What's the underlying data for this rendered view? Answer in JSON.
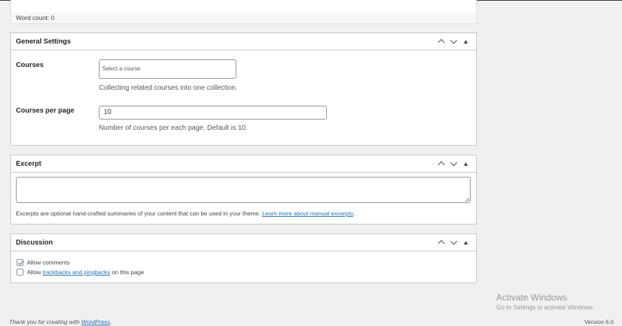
{
  "editor": {
    "word_count": "Word count: 0"
  },
  "general_settings": {
    "title": "General Settings",
    "courses_label": "Courses",
    "courses_placeholder": "Select a course",
    "courses_description": "Collecting related courses into one collection.",
    "per_page_label": "Courses per page",
    "per_page_value": "10",
    "per_page_description": "Number of courses per each page. Default is 10."
  },
  "excerpt": {
    "title": "Excerpt",
    "value": "",
    "note": "Excerpts are optional hand-crafted summaries of your content that can be used in your theme.",
    "learn_more": "Learn more about manual excerpts",
    "period": "."
  },
  "discussion": {
    "title": "Discussion",
    "allow_comments": "Allow comments",
    "allow_comments_checked": true,
    "allow_pingbacks_prefix": "Allow",
    "pingbacks_link": "trackbacks and pingbacks",
    "allow_pingbacks_suffix": "on this page",
    "allow_pingbacks_checked": false
  },
  "footer": {
    "thanks_prefix": "Thank you for creating with",
    "wordpress_link": "WordPress",
    "thanks_suffix": ".",
    "version": "Version 6.0"
  },
  "watermark": {
    "title": "Activate Windows",
    "subtitle": "Go to Settings to activate Windows."
  },
  "icons": [
    "chevron-up-icon",
    "chevron-down-icon",
    "toggle-arrow-icon",
    "checkmark-icon",
    "resize-grip-icon"
  ]
}
